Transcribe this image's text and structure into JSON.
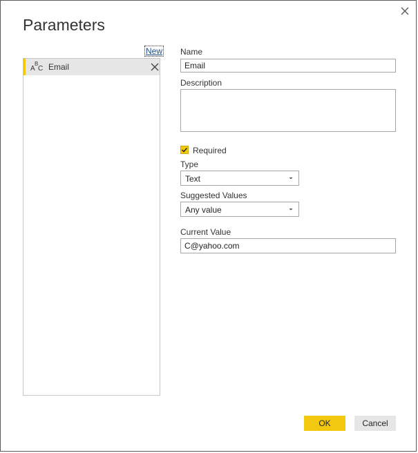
{
  "dialog": {
    "title": "Parameters"
  },
  "list": {
    "new_label": "New",
    "items": [
      {
        "icon": "text-type-icon",
        "icon_letters": [
          "A",
          "B",
          "C"
        ],
        "label": "Email"
      }
    ]
  },
  "form": {
    "name_label": "Name",
    "name_value": "Email",
    "description_label": "Description",
    "description_value": "",
    "required_label": "Required",
    "required_checked": true,
    "type_label": "Type",
    "type_value": "Text",
    "suggested_label": "Suggested Values",
    "suggested_value": "Any value",
    "current_label": "Current Value",
    "current_value": "C@yahoo.com"
  },
  "buttons": {
    "ok_label": "OK",
    "cancel_label": "Cancel"
  },
  "colors": {
    "accent": "#f2c811",
    "selected_row": "#e6e6e6",
    "cancel_button": "#e6e6e6",
    "link": "#1f4e8a"
  }
}
